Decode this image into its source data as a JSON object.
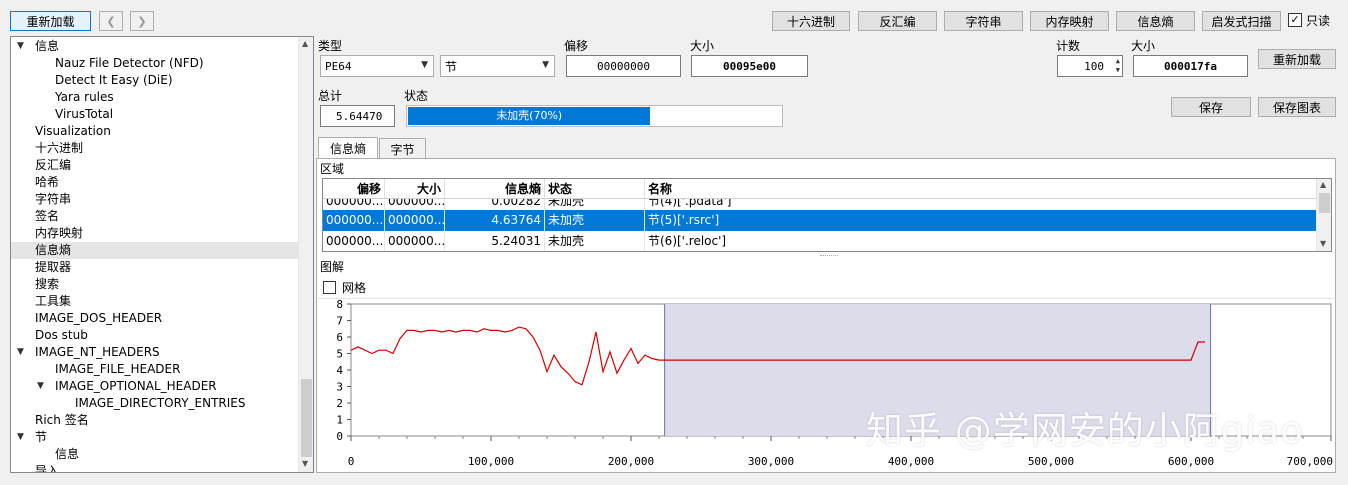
{
  "toolbar": {
    "reload": "重新加载",
    "back_icon": "chevron-left-icon",
    "forward_icon": "chevron-right-icon",
    "hex": "十六进制",
    "disasm": "反汇编",
    "strings": "字符串",
    "memmap": "内存映射",
    "entropy": "信息熵",
    "heuristic": "启发式扫描",
    "readonly": "只读",
    "readonly_checked": true
  },
  "tree": {
    "items": [
      {
        "label": "信息",
        "level": 1,
        "caret": "▼"
      },
      {
        "label": "Nauz File Detector (NFD)",
        "level": 2
      },
      {
        "label": "Detect It Easy (DiE)",
        "level": 2
      },
      {
        "label": "Yara rules",
        "level": 2
      },
      {
        "label": "VirusTotal",
        "level": 2
      },
      {
        "label": "Visualization",
        "level": 1
      },
      {
        "label": "十六进制",
        "level": 1
      },
      {
        "label": "反汇编",
        "level": 1
      },
      {
        "label": "哈希",
        "level": 1
      },
      {
        "label": "字符串",
        "level": 1
      },
      {
        "label": "签名",
        "level": 1
      },
      {
        "label": "内存映射",
        "level": 1
      },
      {
        "label": "信息熵",
        "level": 1,
        "selected": true
      },
      {
        "label": "提取器",
        "level": 1
      },
      {
        "label": "搜索",
        "level": 1
      },
      {
        "label": "工具集",
        "level": 1
      },
      {
        "label": "IMAGE_DOS_HEADER",
        "level": 1
      },
      {
        "label": "Dos stub",
        "level": 1
      },
      {
        "label": "IMAGE_NT_HEADERS",
        "level": 1,
        "caret": "▼"
      },
      {
        "label": "IMAGE_FILE_HEADER",
        "level": 2
      },
      {
        "label": "IMAGE_OPTIONAL_HEADER",
        "level": 2,
        "caret": "▼"
      },
      {
        "label": "IMAGE_DIRECTORY_ENTRIES",
        "level": 3
      },
      {
        "label": "Rich 签名",
        "level": 1
      },
      {
        "label": "节",
        "level": 1,
        "caret": "▼"
      },
      {
        "label": "信息",
        "level": 2
      },
      {
        "label": "导入",
        "level": 1
      }
    ]
  },
  "form": {
    "type_label": "类型",
    "type_value": "PE64",
    "section_value": "节",
    "offset_label": "偏移",
    "offset_value": "00000000",
    "size_label": "大小",
    "size_value": "00095e00",
    "count_label": "计数",
    "count_value": "100",
    "size2_label": "大小",
    "size2_value": "000017fa",
    "reload": "重新加载",
    "total_label": "总计",
    "total_value": "5.64470",
    "status_label": "状态",
    "status_value": "未加壳(70%)",
    "status_progress": 0.65,
    "save": "保存",
    "save_chart": "保存图表"
  },
  "tabs": [
    {
      "label": "信息熵",
      "active": true
    },
    {
      "label": "字节",
      "active": false
    }
  ],
  "region_label": "区域",
  "table": {
    "columns": [
      "偏移",
      "大小",
      "信息熵",
      "状态",
      "名称"
    ],
    "rows": [
      {
        "offset": "000000...",
        "size": "000000...",
        "entropy": "0.00282",
        "status": "未加壳",
        "name": "节(4)['.pdata']",
        "partial": true
      },
      {
        "offset": "000000...",
        "size": "000000...",
        "entropy": "4.63764",
        "status": "未加壳",
        "name": "节(5)['.rsrc']",
        "selected": true
      },
      {
        "offset": "000000...",
        "size": "000000...",
        "entropy": "5.24031",
        "status": "未加壳",
        "name": "节(6)['.reloc']"
      }
    ]
  },
  "chart_section_label": "图解",
  "grid_label": "网格",
  "grid_checked": false,
  "chart_data": {
    "type": "line",
    "x": [
      0,
      5000,
      10000,
      15000,
      20000,
      25000,
      30000,
      35000,
      40000,
      45000,
      50000,
      55000,
      60000,
      65000,
      70000,
      75000,
      80000,
      85000,
      90000,
      95000,
      100000,
      105000,
      110000,
      115000,
      120000,
      125000,
      130000,
      135000,
      140000,
      145000,
      150000,
      155000,
      160000,
      165000,
      170000,
      175000,
      180000,
      185000,
      190000,
      195000,
      200000,
      205000,
      210000,
      215000,
      220000,
      225000,
      240000,
      260000,
      280000,
      300000,
      320000,
      340000,
      360000,
      380000,
      400000,
      420000,
      440000,
      460000,
      480000,
      500000,
      520000,
      540000,
      560000,
      580000,
      600000,
      605000,
      610000
    ],
    "y": [
      5.2,
      5.4,
      5.2,
      5.0,
      5.2,
      5.2,
      5.0,
      5.9,
      6.4,
      6.4,
      6.3,
      6.4,
      6.4,
      6.3,
      6.4,
      6.3,
      6.4,
      6.4,
      6.3,
      6.5,
      6.4,
      6.4,
      6.3,
      6.4,
      6.6,
      6.5,
      6.0,
      5.2,
      3.9,
      4.9,
      4.2,
      3.8,
      3.3,
      3.1,
      4.5,
      6.3,
      3.9,
      5.1,
      3.8,
      4.6,
      5.3,
      4.4,
      4.9,
      4.7,
      4.6,
      4.6,
      4.6,
      4.6,
      4.6,
      4.6,
      4.6,
      4.6,
      4.6,
      4.6,
      4.6,
      4.6,
      4.6,
      4.6,
      4.6,
      4.6,
      4.6,
      4.6,
      4.6,
      4.6,
      4.6,
      5.7,
      5.7
    ],
    "xlim": [
      0,
      700000
    ],
    "ylim": [
      0,
      8
    ],
    "xticks": [
      "0",
      "100,000",
      "200,000",
      "300,000",
      "400,000",
      "500,000",
      "600,000",
      "700,000"
    ],
    "yticks": [
      "0",
      "1",
      "2",
      "3",
      "4",
      "5",
      "6",
      "7",
      "8"
    ],
    "highlight_range": [
      224000,
      614000
    ],
    "line_color": "#d40000",
    "highlight_color": "#dcdceb",
    "grid": false
  },
  "watermark": "知乎 @学网安的小阿giao",
  "colors": {
    "selection": "#0078d7",
    "accent": "#0078d7"
  }
}
